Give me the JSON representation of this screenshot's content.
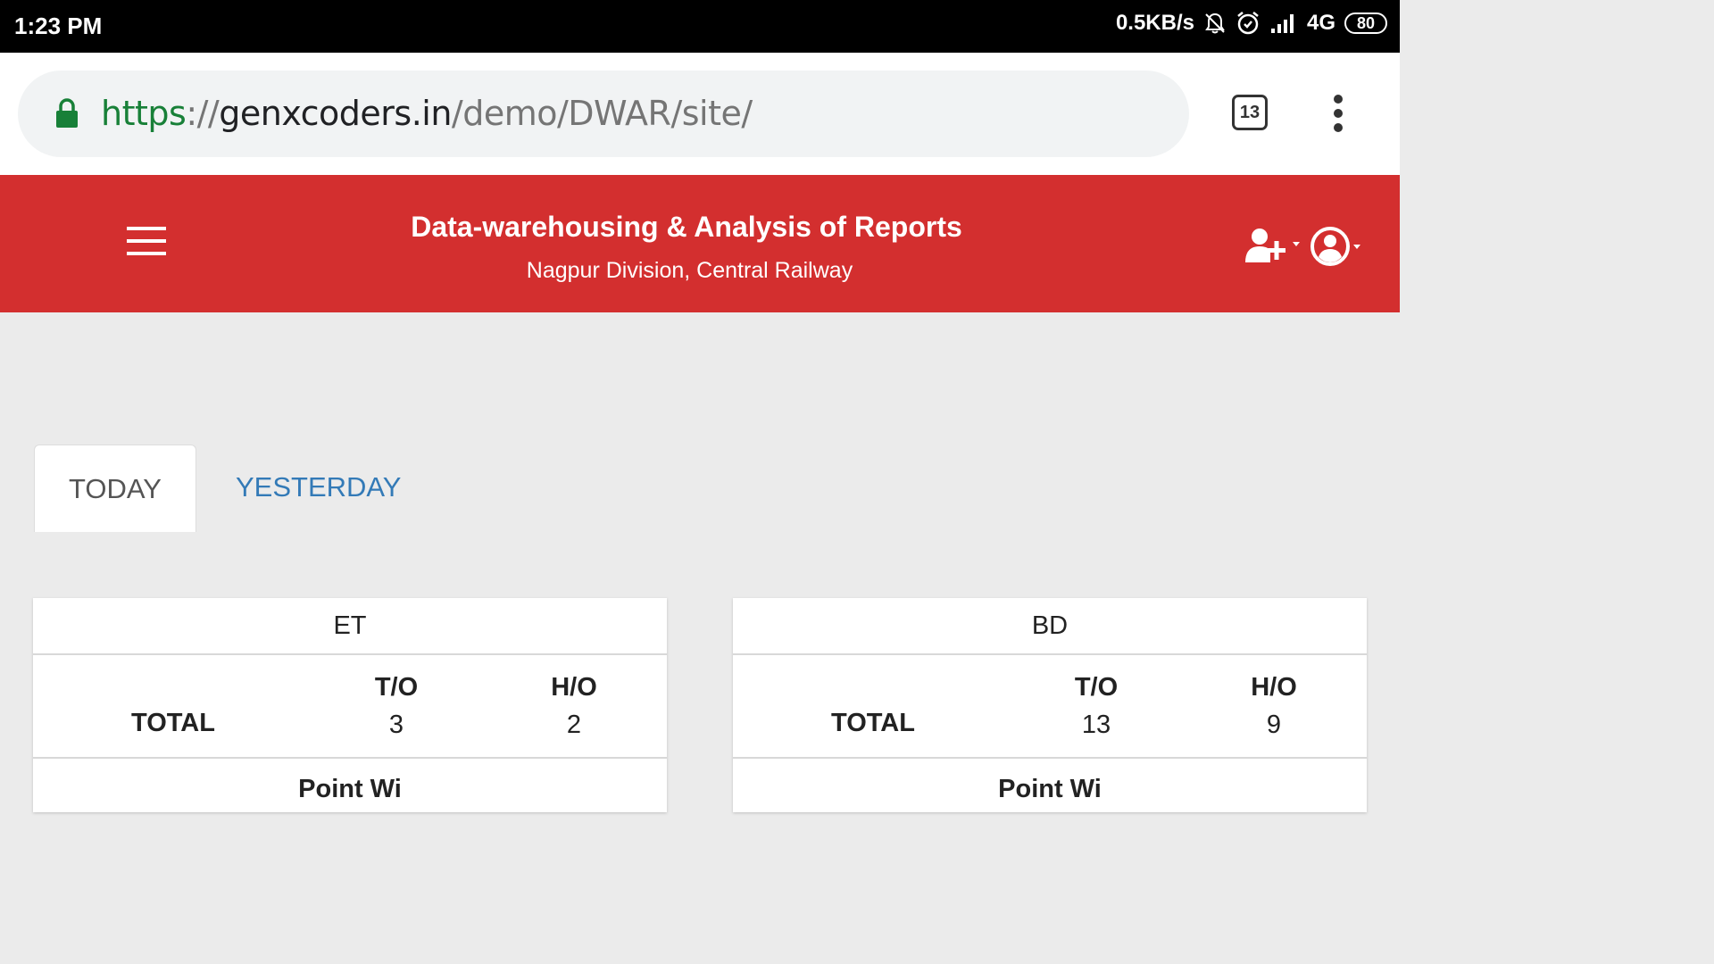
{
  "status_bar": {
    "time": "1:23 PM",
    "net_speed": "0.5KB/s",
    "network": "4G",
    "battery": "80",
    "icons": [
      "notifications-off-icon",
      "alarm-icon",
      "signal-icon"
    ]
  },
  "browser": {
    "url": {
      "scheme": "https",
      "separator": "://",
      "host": "genxcoders.in",
      "path": "/demo/DWAR/site/"
    },
    "tab_count": "13"
  },
  "header": {
    "title": "Data-warehousing & Analysis of Reports",
    "subtitle": "Nagpur Division, Central Railway",
    "color": "#d32f2f"
  },
  "tabs": [
    {
      "label": "TODAY",
      "active": true
    },
    {
      "label": "YESTERDAY",
      "active": false
    }
  ],
  "cards": [
    {
      "title": "ET",
      "row_label": "TOTAL",
      "columns": [
        "T/O",
        "H/O"
      ],
      "values": [
        "3",
        "2"
      ],
      "next_section": "Point Wi"
    },
    {
      "title": "BD",
      "row_label": "TOTAL",
      "columns": [
        "T/O",
        "H/O"
      ],
      "values": [
        "13",
        "9"
      ],
      "next_section": "Point Wi"
    }
  ]
}
